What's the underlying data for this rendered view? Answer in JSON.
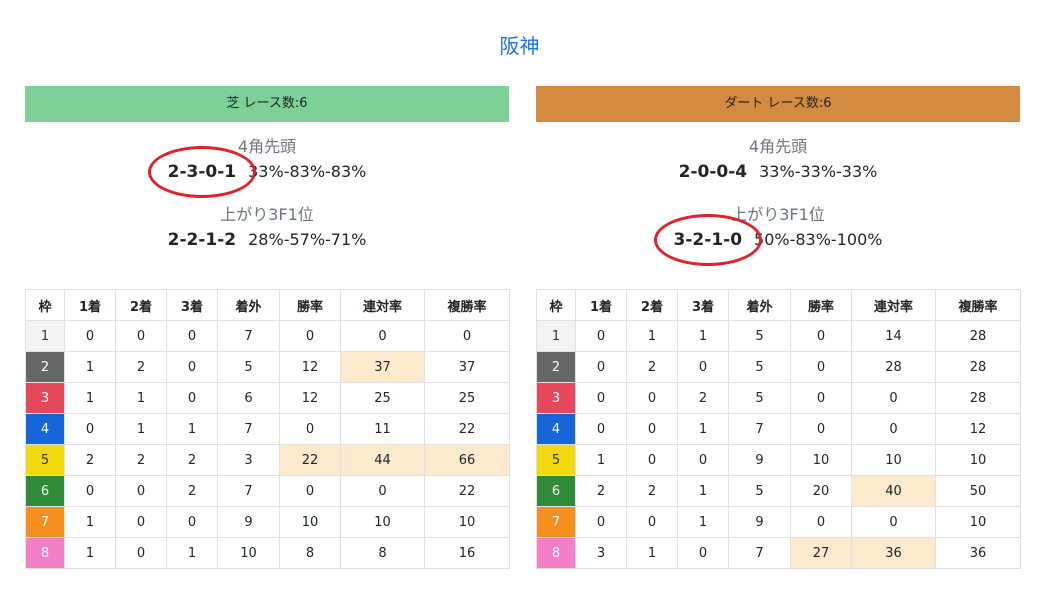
{
  "venue": "阪神",
  "panels": [
    {
      "header": "芝 レース数:6",
      "header_color": "#7dd197",
      "stat1_label": "4角先頭",
      "stat1_record": "2-3-0-1",
      "stat1_rates": "33%-83%-83%",
      "stat1_circled": true,
      "stat2_label": "上がり3F1位",
      "stat2_record": "2-2-1-2",
      "stat2_rates": "28%-57%-71%",
      "stat2_circled": false,
      "columns": [
        "枠",
        "1着",
        "2着",
        "3着",
        "着外",
        "勝率",
        "連対率",
        "複勝率"
      ],
      "rows": [
        [
          "1",
          "0",
          "0",
          "0",
          "7",
          "0",
          "0",
          "0"
        ],
        [
          "2",
          "1",
          "2",
          "0",
          "5",
          "12",
          "37",
          "37"
        ],
        [
          "3",
          "1",
          "1",
          "0",
          "6",
          "12",
          "25",
          "25"
        ],
        [
          "4",
          "0",
          "1",
          "1",
          "7",
          "0",
          "11",
          "22"
        ],
        [
          "5",
          "2",
          "2",
          "2",
          "3",
          "22",
          "44",
          "66"
        ],
        [
          "6",
          "0",
          "0",
          "2",
          "7",
          "0",
          "0",
          "22"
        ],
        [
          "7",
          "1",
          "0",
          "0",
          "9",
          "10",
          "10",
          "10"
        ],
        [
          "8",
          "1",
          "0",
          "1",
          "10",
          "8",
          "8",
          "16"
        ]
      ],
      "highlights": [
        [
          1,
          6
        ],
        [
          4,
          5
        ],
        [
          4,
          6
        ],
        [
          4,
          7
        ]
      ]
    },
    {
      "header": "ダート レース数:6",
      "header_color": "#d48a40",
      "stat1_label": "4角先頭",
      "stat1_record": "2-0-0-4",
      "stat1_rates": "33%-33%-33%",
      "stat1_circled": false,
      "stat2_label": "上がり3F1位",
      "stat2_record": "3-2-1-0",
      "stat2_rates": "50%-83%-100%",
      "stat2_circled": true,
      "columns": [
        "枠",
        "1着",
        "2着",
        "3着",
        "着外",
        "勝率",
        "連対率",
        "複勝率"
      ],
      "rows": [
        [
          "1",
          "0",
          "1",
          "1",
          "5",
          "0",
          "14",
          "28"
        ],
        [
          "2",
          "0",
          "2",
          "0",
          "5",
          "0",
          "28",
          "28"
        ],
        [
          "3",
          "0",
          "0",
          "2",
          "5",
          "0",
          "0",
          "28"
        ],
        [
          "4",
          "0",
          "0",
          "1",
          "7",
          "0",
          "0",
          "12"
        ],
        [
          "5",
          "1",
          "0",
          "0",
          "9",
          "10",
          "10",
          "10"
        ],
        [
          "6",
          "2",
          "2",
          "1",
          "5",
          "20",
          "40",
          "50"
        ],
        [
          "7",
          "0",
          "0",
          "1",
          "9",
          "0",
          "0",
          "10"
        ],
        [
          "8",
          "3",
          "1",
          "0",
          "7",
          "27",
          "36",
          "36"
        ]
      ],
      "highlights": [
        [
          5,
          6
        ],
        [
          7,
          5
        ],
        [
          7,
          6
        ]
      ]
    }
  ],
  "frame_colors": {
    "1": {
      "bg": "#f4f4f4",
      "fg": "#333333"
    },
    "2": {
      "bg": "#666666",
      "fg": "#ffffff"
    },
    "3": {
      "bg": "#e8475a",
      "fg": "#ffffff"
    },
    "4": {
      "bg": "#1565d8",
      "fg": "#ffffff"
    },
    "5": {
      "bg": "#f2d90f",
      "fg": "#333333"
    },
    "6": {
      "bg": "#2e8b37",
      "fg": "#ffffff"
    },
    "7": {
      "bg": "#f5901e",
      "fg": "#ffffff"
    },
    "8": {
      "bg": "#f57ec9",
      "fg": "#ffffff"
    }
  }
}
